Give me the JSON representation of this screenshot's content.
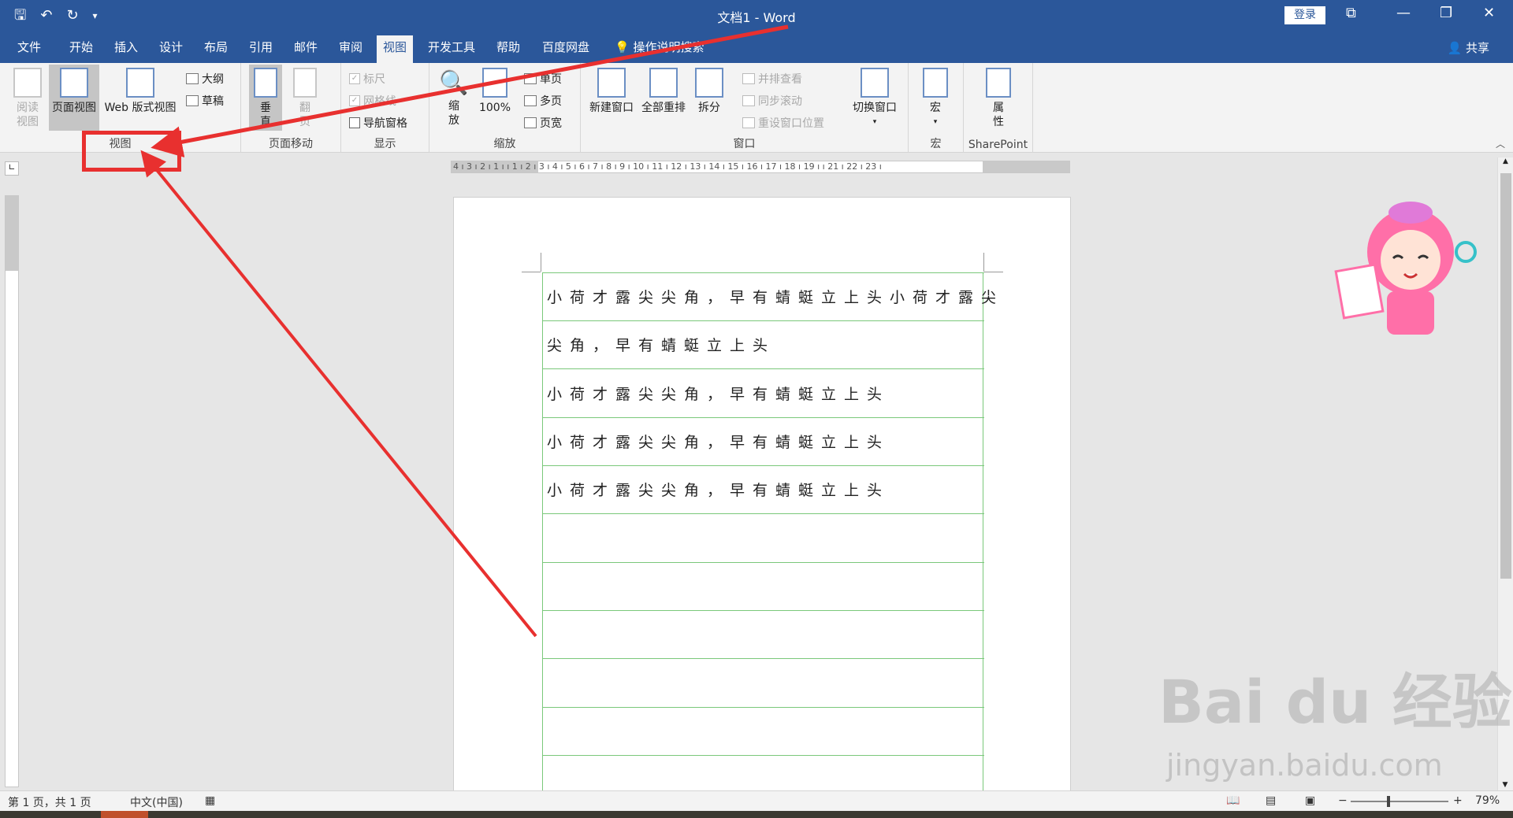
{
  "title_bar": {
    "title": "文档1 - Word",
    "login_label": "登录",
    "qat_icons": [
      "save-icon",
      "undo-icon",
      "redo-icon",
      "customize-qat-icon"
    ]
  },
  "tabs": [
    "文件",
    "开始",
    "插入",
    "设计",
    "布局",
    "引用",
    "邮件",
    "审阅",
    "视图",
    "开发工具",
    "帮助",
    "百度网盘"
  ],
  "active_tab": "视图",
  "tell_me": "操作说明搜索",
  "share_label": "共享",
  "ribbon": {
    "views": {
      "read_mode_l1": "阅读",
      "read_mode_l2": "视图",
      "print_layout": "页面视图",
      "web_layout": "Web 版式视图",
      "outline": "大纲",
      "draft": "草稿",
      "group_label": "视图"
    },
    "page_movement": {
      "vertical_l1": "垂",
      "vertical_l2": "直",
      "side_l1": "翻",
      "side_l2": "页",
      "group_label": "页面移动"
    },
    "show": {
      "ruler": "标尺",
      "gridlines": "网格线",
      "nav_pane": "导航窗格",
      "group_label": "显示",
      "ruler_checked": true,
      "gridlines_checked": true,
      "nav_pane_checked": false
    },
    "zoom": {
      "zoom_l1": "缩",
      "zoom_l2": "放",
      "hundred": "100%",
      "one_page": "单页",
      "multi_page": "多页",
      "page_width": "页宽",
      "group_label": "缩放"
    },
    "window": {
      "new_window": "新建窗口",
      "arrange_all": "全部重排",
      "split": "拆分",
      "side_by_side": "并排查看",
      "sync_scroll": "同步滚动",
      "reset_pos": "重设窗口位置",
      "switch_window": "切换窗口",
      "group_label": "窗口"
    },
    "macros": {
      "macro": "宏",
      "group_label": "宏"
    },
    "sharepoint": {
      "properties_l1": "属",
      "properties_l2": "性",
      "group_label": "SharePoint"
    }
  },
  "ruler_h": "4 ı 3 ı 2 ı 1 ı    ı 1 ı 2 ı 3 ı 4 ı 5 ı 6 ı 7 ı 8 ı 9 ı 10 ı 11 ı 12 ı 13 ı 14 ı 15 ı 16 ı 17 ı 18 ı 19 ı    ı 21 ı 22 ı 23 ı",
  "document": {
    "lines": [
      "小荷才露尖尖角，早有蜻蜓立上头小荷才露尖",
      "尖角，早有蜻蜓立上头",
      "小荷才露尖尖角，早有蜻蜓立上头",
      "小荷才露尖尖角，早有蜻蜓立上头",
      "小荷才露尖尖角，早有蜻蜓立上头"
    ]
  },
  "status_bar": {
    "page_info": "第 1 页，共 1 页",
    "language": "中文(中国)",
    "zoom": "79%"
  },
  "watermark": {
    "main": "Bai du 经验",
    "url": "jingyan.baidu.com"
  },
  "annotation_color": "#e8302f"
}
